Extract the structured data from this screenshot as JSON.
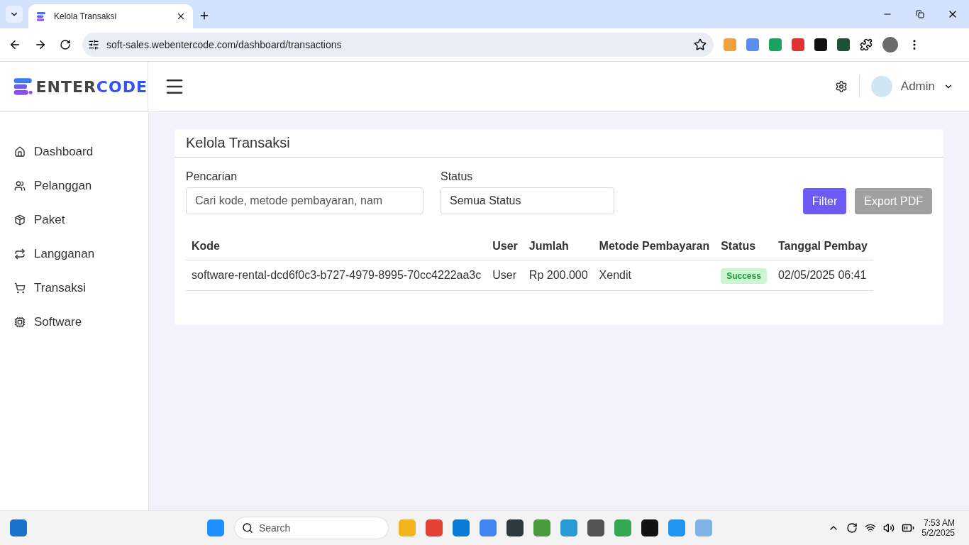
{
  "browser": {
    "tab_title": "Kelola Transaksi",
    "url": "soft-sales.webentercode.com/dashboard/transactions"
  },
  "header": {
    "logo_left": "ENTER",
    "logo_right": "CODE",
    "user": "Admin"
  },
  "sidebar": {
    "items": [
      {
        "label": "Dashboard"
      },
      {
        "label": "Pelanggan"
      },
      {
        "label": "Paket"
      },
      {
        "label": "Langganan"
      },
      {
        "label": "Transaksi"
      },
      {
        "label": "Software"
      }
    ]
  },
  "card": {
    "title": "Kelola Transaksi",
    "search": {
      "label": "Pencarian",
      "placeholder": "Cari kode, metode pembayaran, nam"
    },
    "status_filter": {
      "label": "Status",
      "value": "Semua Status"
    },
    "buttons": [
      {
        "label": "Filter",
        "kind": "primary"
      },
      {
        "label": "Export PDF",
        "kind": "secondary"
      }
    ],
    "table": {
      "columns": [
        "Kode",
        "User",
        "Jumlah",
        "Metode Pembayaran",
        "Status",
        "Tanggal Pembay"
      ],
      "rows": [
        {
          "code": "software-rental-dcd6f0c3-b727-4979-8995-70cc4222aa3c",
          "user": "User",
          "amount": "Rp 200.000",
          "method": "Xendit",
          "status": "Success",
          "date": "02/05/2025 06:41"
        }
      ]
    }
  },
  "taskbar": {
    "search_placeholder": "Search",
    "time": "7:53 AM",
    "date": "5/2/2025"
  }
}
